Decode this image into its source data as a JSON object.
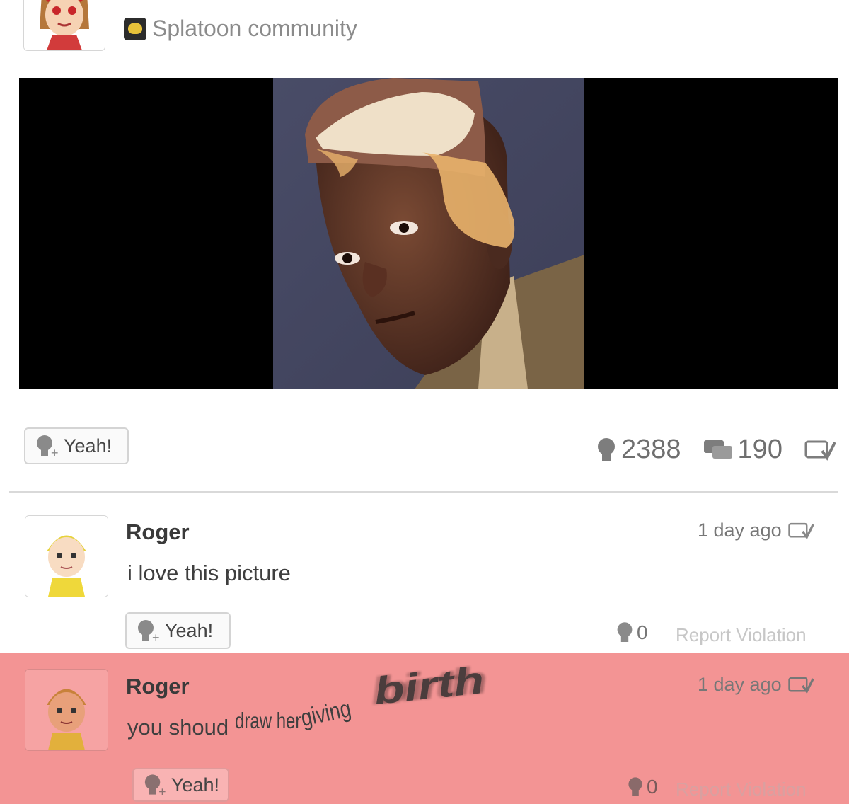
{
  "post": {
    "community_name": "Splatoon community",
    "yeah_label": "Yeah!",
    "yeah_count": "2388",
    "comment_count": "190"
  },
  "comments": [
    {
      "author": "Roger",
      "text": "i love this picture",
      "time": "1 day ago",
      "yeah_label": "Yeah!",
      "yeah_count": "0",
      "report_label": "Report Violation"
    },
    {
      "author": "Roger",
      "text_parts": [
        "you shoud",
        "draw her",
        "giving",
        "birth"
      ],
      "time": "1 day ago",
      "yeah_label": "Yeah!",
      "yeah_count": "0",
      "report_label": "Report Violation"
    }
  ],
  "colors": {
    "highlight": "#f39494",
    "muted_text": "#8b8b8b",
    "divider": "#d9d9d9"
  },
  "icons": [
    "mii-avatar",
    "community-icon",
    "yeah-plus-icon",
    "yeah-icon",
    "comment-icon",
    "spoiler-check-icon"
  ]
}
